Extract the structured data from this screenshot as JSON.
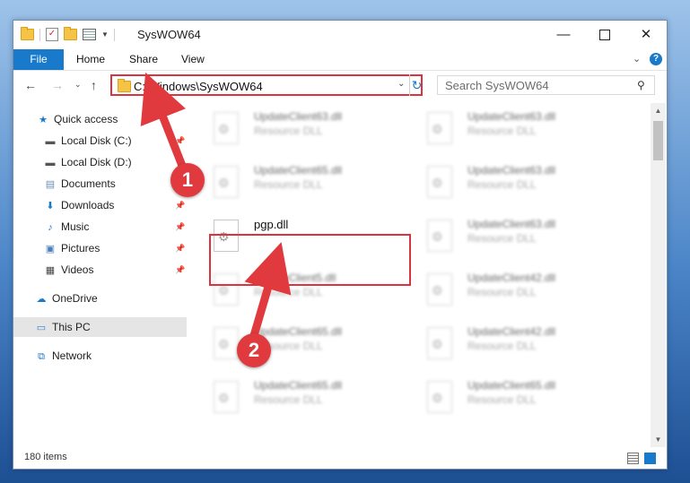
{
  "window": {
    "title": "SysWOW64"
  },
  "ribbon": {
    "tabs": [
      "File",
      "Home",
      "Share",
      "View"
    ],
    "help": "?"
  },
  "address": {
    "path": "C:\\Windows\\SysWOW64",
    "search_placeholder": "Search SysWOW64"
  },
  "navpane": {
    "items": [
      {
        "label": "Quick access",
        "icon": "star-icon"
      },
      {
        "label": "Local Disk (C:)",
        "icon": "drive-icon"
      },
      {
        "label": "Local Disk (D:)",
        "icon": "drive-icon"
      },
      {
        "label": "Documents",
        "icon": "documents-icon"
      },
      {
        "label": "Downloads",
        "icon": "download-icon"
      },
      {
        "label": "Music",
        "icon": "music-icon"
      },
      {
        "label": "Pictures",
        "icon": "pictures-icon"
      },
      {
        "label": "Videos",
        "icon": "videos-icon"
      },
      {
        "label": "OneDrive",
        "icon": "cloud-icon"
      },
      {
        "label": "This PC",
        "icon": "computer-icon"
      },
      {
        "label": "Network",
        "icon": "network-icon"
      }
    ]
  },
  "files": [
    {
      "name": "UpdateClient63.dll",
      "type": "Resource DLL"
    },
    {
      "name": "UpdateClient63.dll",
      "type": "Resource DLL"
    },
    {
      "name": "UpdateClient65.dll",
      "type": "Resource DLL"
    },
    {
      "name": "UpdateClient63.dll",
      "type": "Resource DLL"
    },
    {
      "name": "pgp.dll",
      "type": ""
    },
    {
      "name": "UpdateClient63.dll",
      "type": "Resource DLL"
    },
    {
      "name": "UpdateClient5.dll",
      "type": "Resource DLL"
    },
    {
      "name": "UpdateClient42.dll",
      "type": "Resource DLL"
    },
    {
      "name": "UpdateClient65.dll",
      "type": "Resource DLL"
    },
    {
      "name": "UpdateClient42.dll",
      "type": "Resource DLL"
    },
    {
      "name": "UpdateClient65.dll",
      "type": "Resource DLL"
    },
    {
      "name": "UpdateClient65.dll",
      "type": "Resource DLL"
    }
  ],
  "status": {
    "item_count": "180 items"
  },
  "annotations": {
    "step1": "1",
    "step2": "2",
    "color": "#d9343f"
  }
}
